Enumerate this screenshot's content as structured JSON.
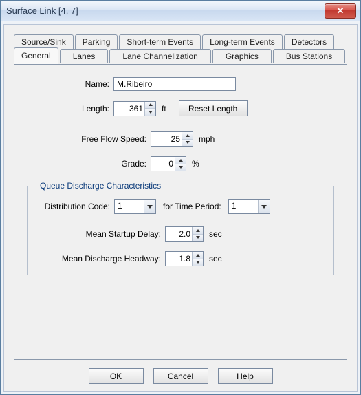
{
  "window": {
    "title": "Surface Link [4, 7]"
  },
  "tabs_row1": [
    "Source/Sink",
    "Parking",
    "Short-term Events",
    "Long-term Events",
    "Detectors"
  ],
  "tabs_row2": [
    "General",
    "Lanes",
    "Lane Channelization",
    "Graphics",
    "Bus Stations"
  ],
  "active_tab": "General",
  "form": {
    "name_label": "Name:",
    "name_value": "M.Ribeiro",
    "length_label": "Length:",
    "length_value": "361",
    "length_unit": "ft",
    "reset_length_label": "Reset Length",
    "ffs_label": "Free Flow Speed:",
    "ffs_value": "25",
    "ffs_unit": "mph",
    "grade_label": "Grade:",
    "grade_value": "0",
    "grade_unit": "%"
  },
  "queue": {
    "legend": "Queue Discharge Characteristics",
    "dist_label": "Distribution Code:",
    "dist_value": "1",
    "period_label": "for Time Period:",
    "period_value": "1",
    "startup_label": "Mean Startup Delay:",
    "startup_value": "2.0",
    "startup_unit": "sec",
    "headway_label": "Mean Discharge Headway:",
    "headway_value": "1.8",
    "headway_unit": "sec"
  },
  "buttons": {
    "ok": "OK",
    "cancel": "Cancel",
    "help": "Help"
  }
}
